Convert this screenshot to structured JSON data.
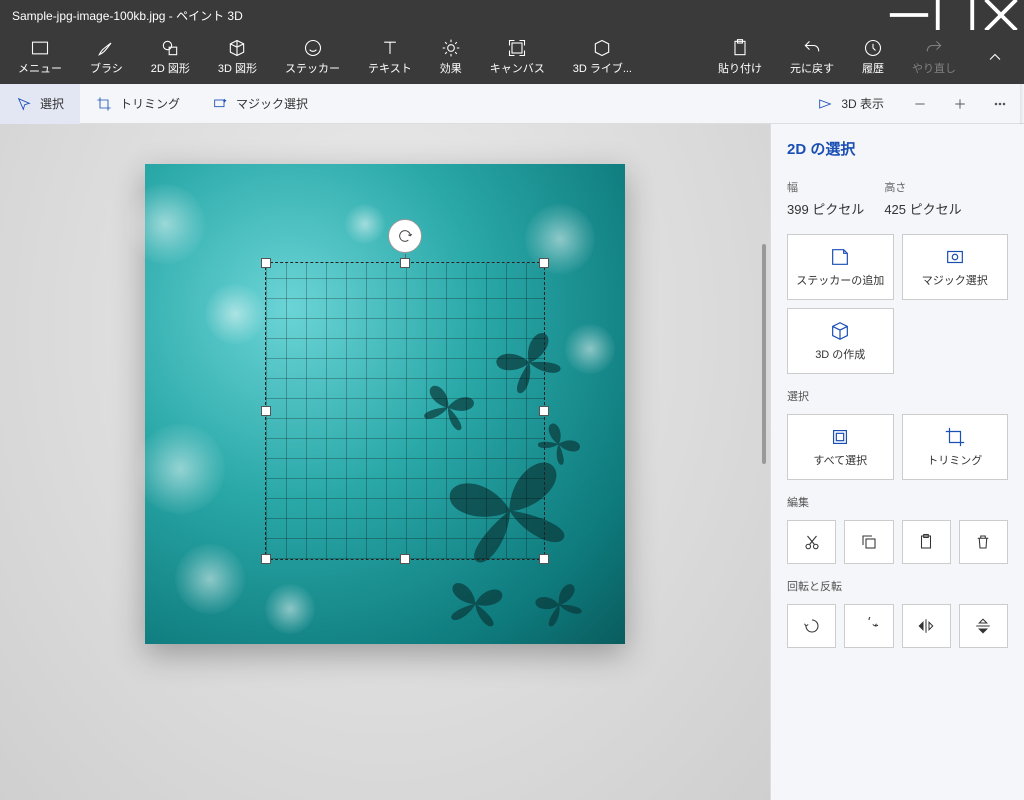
{
  "title": "Sample-jpg-image-100kb.jpg - ペイント 3D",
  "ribbon": {
    "menu": "メニュー",
    "brush": "ブラシ",
    "shapes2d": "2D 図形",
    "shapes3d": "3D 図形",
    "sticker": "ステッカー",
    "text": "テキスト",
    "effects": "効果",
    "canvas": "キャンバス",
    "lib3d": "3D ライブ...",
    "paste": "貼り付け",
    "undo": "元に戻す",
    "history": "履歴",
    "redo": "やり直し"
  },
  "subbar": {
    "select": "選択",
    "crop": "トリミング",
    "magic": "マジック選択",
    "view3d": "3D 表示"
  },
  "panel": {
    "title": "2D の選択",
    "widthLabel": "幅",
    "widthValue": "399 ピクセル",
    "heightLabel": "高さ",
    "heightValue": "425 ピクセル",
    "addSticker": "ステッカーの追加",
    "magicSelect": "マジック選択",
    "make3d": "3D の作成",
    "sectionSelect": "選択",
    "selectAll": "すべて選択",
    "crop": "トリミング",
    "sectionEdit": "編集",
    "sectionRotate": "回転と反転"
  }
}
